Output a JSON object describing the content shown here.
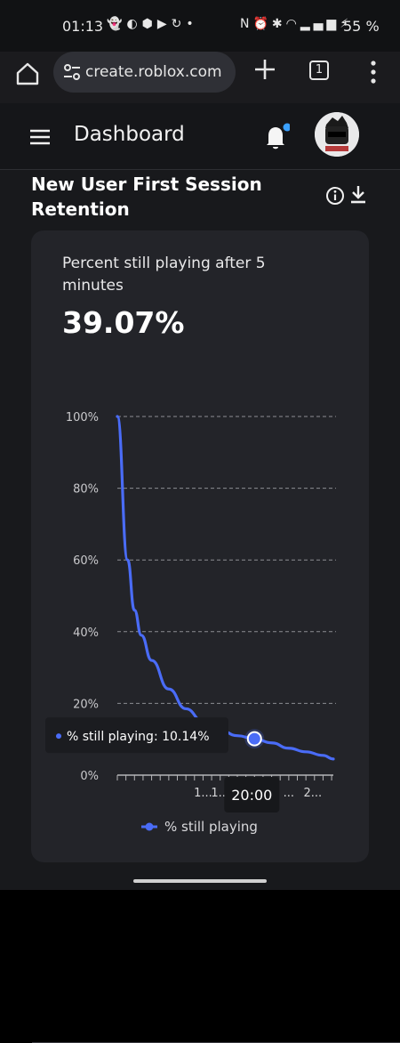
{
  "status_bar": {
    "time": "01:13",
    "battery": "55 %",
    "left_icons": [
      "snapchat-icon",
      "discord-icon",
      "shield-app-icon",
      "youtube-icon",
      "sync-icon",
      "dot-icon"
    ],
    "right_icons": [
      "nfc-icon",
      "alarm-icon",
      "bluetooth-icon",
      "wifi-icon",
      "signal-icon",
      "charging-icon"
    ]
  },
  "browser": {
    "url": "create.roblox.com",
    "tab_count": "1"
  },
  "header": {
    "title": "Dashboard",
    "notification_dot_color": "#3aa0ff"
  },
  "section": {
    "title": "New User First Session Retention"
  },
  "metric": {
    "label": "Percent still playing after 5 minutes",
    "value": "39.07%"
  },
  "chart_data": {
    "type": "line",
    "title": "",
    "xlabel": "",
    "ylabel": "",
    "ylim": [
      0,
      100
    ],
    "y_ticks": [
      "100%",
      "80%",
      "60%",
      "40%",
      "20%",
      "0%"
    ],
    "x_tick_labels": [
      "1...",
      "1...",
      "20:00",
      "...",
      "2..."
    ],
    "x_tick_label_positions_min": [
      25,
      30,
      40,
      50,
      57
    ],
    "x_range_min": [
      0,
      63
    ],
    "grid": true,
    "legend_position": "bottom",
    "series": [
      {
        "name": "% still playing",
        "color": "#4a6cf7",
        "x": [
          0,
          3,
          5,
          7,
          10,
          15,
          20,
          25,
          30,
          35,
          40,
          45,
          50,
          55,
          60,
          63
        ],
        "y": [
          100,
          60,
          46,
          39,
          32,
          24,
          18.5,
          15,
          12.5,
          11,
          10.14,
          9,
          7.5,
          6.5,
          5.5,
          4.5
        ]
      }
    ],
    "tooltip": {
      "x_label": "20:00",
      "text": "% still playing: 10.14%",
      "x": 40,
      "y": 10.14
    }
  }
}
